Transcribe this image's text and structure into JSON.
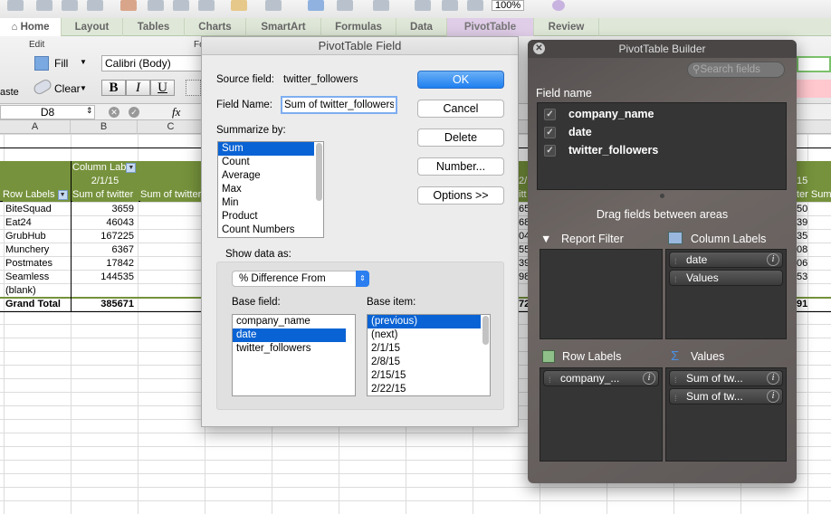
{
  "toolbar": {
    "zoom": "100%"
  },
  "ribbon": {
    "tabs": [
      "Home",
      "Layout",
      "Tables",
      "Charts",
      "SmartArt",
      "Formulas",
      "Data",
      "PivotTable",
      "Review"
    ],
    "edit_label": "Edit",
    "font_label": "Fo",
    "fill": "Fill",
    "clear": "Clear",
    "paste": "aste",
    "font_name": "Calibri (Body)",
    "bold": "B",
    "italic": "I",
    "underline": "U"
  },
  "formula_bar": {
    "name_box": "D8",
    "fx": "fx"
  },
  "columns": [
    "A",
    "B",
    "C"
  ],
  "pivot": {
    "column_labels": "Column Lab",
    "date": "2/1/15",
    "row_labels": "Row Labels",
    "sum_header": "Sum of twitter",
    "sum_header2": "Sum of twitter",
    "rows": [
      {
        "name": "BiteSquad",
        "value": "3659"
      },
      {
        "name": "Eat24",
        "value": "46043"
      },
      {
        "name": "GrubHub",
        "value": "167225"
      },
      {
        "name": "Munchery",
        "value": "6367"
      },
      {
        "name": "Postmates",
        "value": "17842"
      },
      {
        "name": "Seamless",
        "value": "144535"
      },
      {
        "name": "(blank)",
        "value": ""
      }
    ],
    "grand_total_label": "Grand Total",
    "grand_total": "385671",
    "right_date": "15",
    "right_header": "ter Sum",
    "right_values": [
      "50",
      "39",
      "35",
      "08",
      "06",
      "53"
    ],
    "right_total": "91",
    "mid_date": "2/",
    "mid_header": "itt",
    "mid_values": [
      "65",
      "68",
      "04",
      "55",
      "39",
      "98"
    ],
    "mid_total": "72"
  },
  "dialog": {
    "title": "PivotTable Field",
    "source_label": "Source field:",
    "source_value": "twitter_followers",
    "field_name_label": "Field Name:",
    "field_name_value": "Sum of twitter_followers",
    "summarize_label": "Summarize by:",
    "summarize_options": [
      "Sum",
      "Count",
      "Average",
      "Max",
      "Min",
      "Product",
      "Count Numbers"
    ],
    "buttons": {
      "ok": "OK",
      "cancel": "Cancel",
      "delete": "Delete",
      "number": "Number...",
      "options": "Options >>"
    },
    "show_data_label": "Show data as:",
    "show_data_value": "% Difference From",
    "base_field_label": "Base field:",
    "base_fields": [
      "company_name",
      "date",
      "twitter_followers"
    ],
    "base_item_label": "Base item:",
    "base_items": [
      "(previous)",
      "(next)",
      "2/1/15",
      "2/8/15",
      "2/15/15",
      "2/22/15"
    ]
  },
  "builder": {
    "title": "PivotTable Builder",
    "search_placeholder": "Search fields",
    "field_name_label": "Field name",
    "fields": [
      "company_name",
      "date",
      "twitter_followers"
    ],
    "drag_hint": "Drag fields between areas",
    "report_filter": "Report Filter",
    "column_labels": "Column Labels",
    "row_labels": "Row Labels",
    "values": "Values",
    "column_items": [
      "date",
      "Values"
    ],
    "row_items": [
      "company_..."
    ],
    "value_items": [
      "Sum of tw...",
      "Sum of tw..."
    ]
  },
  "colors": {
    "pivot_green": "#76923c",
    "selection_blue": "#0a63d4",
    "ok_blue": "#1f7ff0"
  }
}
